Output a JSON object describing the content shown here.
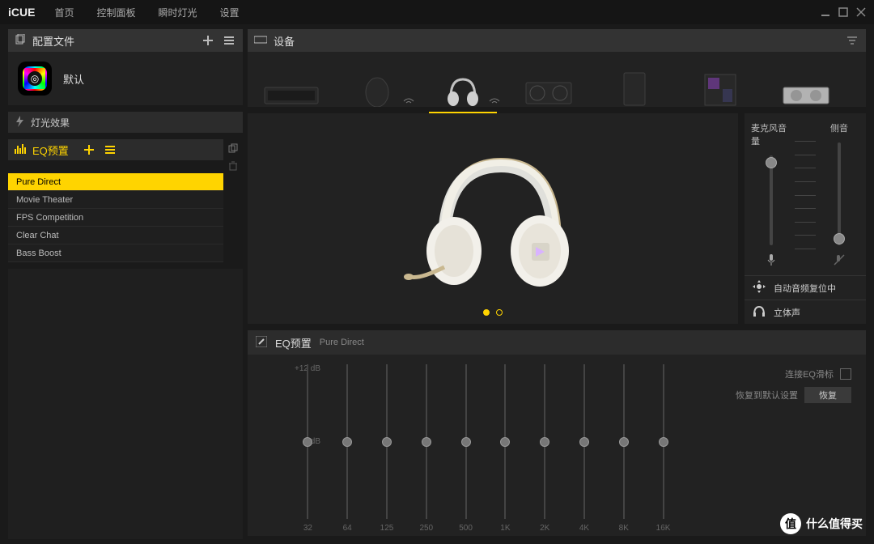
{
  "brand": "iCUE",
  "topnav": {
    "home": "首页",
    "dashboard": "控制面板",
    "instant": "瞬时灯光",
    "settings": "设置"
  },
  "profiles": {
    "title": "配置文件",
    "default_name": "默认"
  },
  "lighting": {
    "title": "灯光效果"
  },
  "eq_presets": {
    "title": "EQ预置",
    "items": [
      "Pure Direct",
      "Movie Theater",
      "FPS Competition",
      "Clear Chat",
      "Bass Boost"
    ],
    "active_index": 0
  },
  "devices": {
    "title": "设备"
  },
  "mic": {
    "label": "麦克风音量"
  },
  "sidetone": {
    "label": "侧音"
  },
  "mode1": "自动音频复位中",
  "mode2": "立体声",
  "eq_panel": {
    "title": "EQ预置",
    "current": "Pure Direct",
    "db_top": "+12 dB",
    "db_mid": "0 dB",
    "freqs": [
      "32",
      "64",
      "125",
      "250",
      "500",
      "1K",
      "2K",
      "4K",
      "8K",
      "16K"
    ],
    "link_label": "连接EQ滑标",
    "reset_label": "恢复到默认设置",
    "reset_btn": "恢复"
  },
  "watermark": {
    "badge": "值",
    "text": "什么值得买"
  }
}
